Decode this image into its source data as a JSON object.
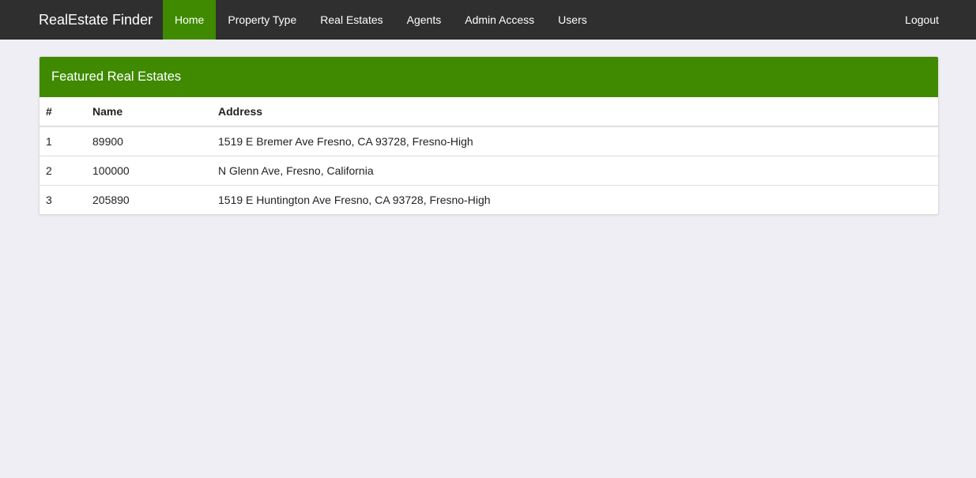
{
  "navbar": {
    "brand": "RealEstate Finder",
    "items": [
      {
        "label": "Home",
        "active": true
      },
      {
        "label": "Property Type",
        "active": false
      },
      {
        "label": "Real Estates",
        "active": false
      },
      {
        "label": "Agents",
        "active": false
      },
      {
        "label": "Admin Access",
        "active": false
      },
      {
        "label": "Users",
        "active": false
      }
    ],
    "logout": "Logout"
  },
  "panel": {
    "title": "Featured Real Estates",
    "columns": [
      "#",
      "Name",
      "Address"
    ],
    "rows": [
      {
        "num": "1",
        "name": "89900",
        "address": "1519 E Bremer Ave Fresno, CA 93728, Fresno-High"
      },
      {
        "num": "2",
        "name": "100000",
        "address": "N Glenn Ave, Fresno, California"
      },
      {
        "num": "3",
        "name": "205890",
        "address": "1519 E Huntington Ave Fresno, CA 93728, Fresno-High"
      }
    ]
  },
  "colors": {
    "navbar_bg": "#2f2f2f",
    "accent_green": "#3f8a00",
    "page_bg": "#efeef4"
  }
}
